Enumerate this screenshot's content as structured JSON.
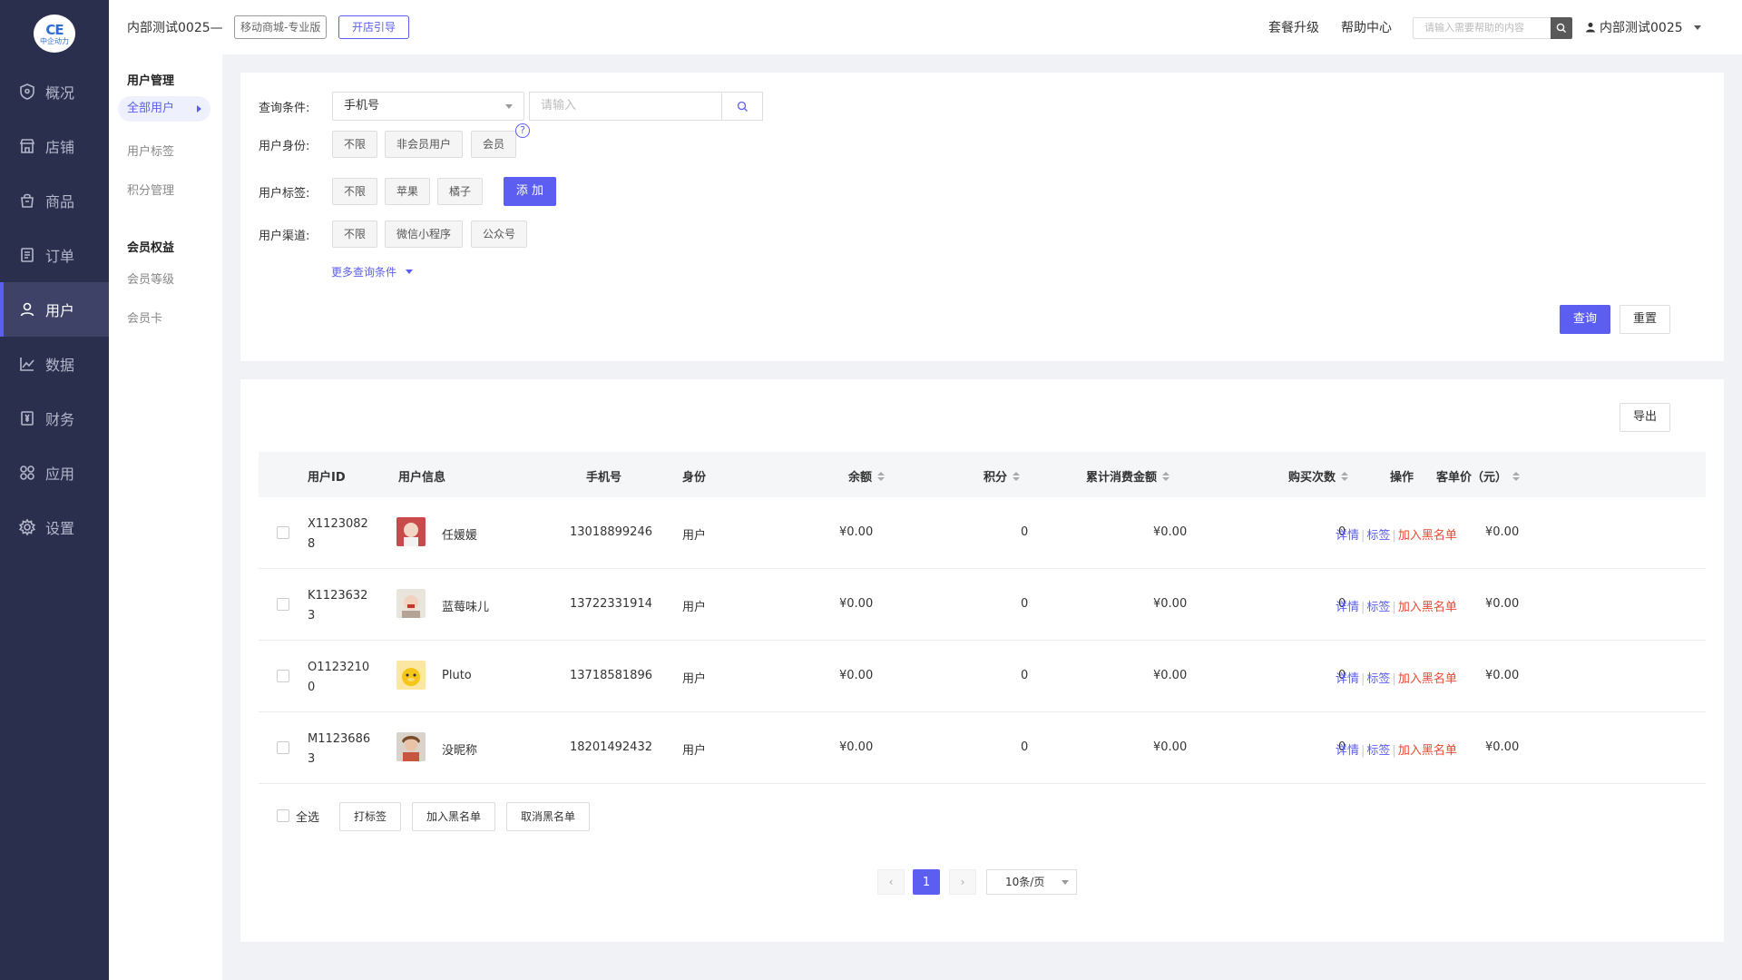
{
  "logo": {
    "mark": "CE",
    "sub": "中企动力"
  },
  "nav": [
    {
      "label": "概况",
      "icon": "shield-icon"
    },
    {
      "label": "店铺",
      "icon": "store-icon"
    },
    {
      "label": "商品",
      "icon": "bag-icon"
    },
    {
      "label": "订单",
      "icon": "order-icon"
    },
    {
      "label": "用户",
      "icon": "user-icon"
    },
    {
      "label": "数据",
      "icon": "chart-icon"
    },
    {
      "label": "财务",
      "icon": "finance-icon"
    },
    {
      "label": "应用",
      "icon": "apps-icon"
    },
    {
      "label": "设置",
      "icon": "gear-icon"
    }
  ],
  "subnav": {
    "group1": "用户管理",
    "items1": [
      "全部用户",
      "用户标签",
      "积分管理"
    ],
    "group2": "会员权益",
    "items2": [
      "会员等级",
      "会员卡"
    ]
  },
  "header": {
    "store": "内部测试0025—",
    "edition": "移动商城-专业版",
    "guide": "开店引导",
    "upgrade": "套餐升级",
    "help": "帮助中心",
    "search_placeholder": "请输入需要帮助的内容",
    "user": "内部测试0025"
  },
  "filters": {
    "query_label": "查询条件:",
    "query_select": "手机号",
    "query_placeholder": "请输入",
    "identity_label": "用户身份:",
    "identity": [
      "不限",
      "非会员用户",
      "会员"
    ],
    "tag_label": "用户标签:",
    "tags": [
      "不限",
      "苹果",
      "橘子"
    ],
    "add": "添 加",
    "channel_label": "用户渠道:",
    "channels": [
      "不限",
      "微信小程序",
      "公众号"
    ],
    "more": "更多查询条件",
    "search": "查询",
    "reset": "重置"
  },
  "table": {
    "export": "导出",
    "headers": {
      "id": "用户ID",
      "info": "用户信息",
      "phone": "手机号",
      "role": "身份",
      "balance": "余额",
      "points": "积分",
      "total": "累计消费金额",
      "count": "购买次数",
      "avg": "客单价（元）",
      "ops": "操作"
    },
    "rows": [
      {
        "id1": "X1123082",
        "id2": "8",
        "name": "任媛媛",
        "phone": "13018899246",
        "role": "用户",
        "balance": "¥0.00",
        "points": "0",
        "total": "¥0.00",
        "count": "0",
        "avg": "¥0.00"
      },
      {
        "id1": "K1123632",
        "id2": "3",
        "name": "蓝莓味儿",
        "phone": "13722331914",
        "role": "用户",
        "balance": "¥0.00",
        "points": "0",
        "total": "¥0.00",
        "count": "0",
        "avg": "¥0.00"
      },
      {
        "id1": "O1123210",
        "id2": "0",
        "name": "Pluto",
        "phone": "13718581896",
        "role": "用户",
        "balance": "¥0.00",
        "points": "0",
        "total": "¥0.00",
        "count": "0",
        "avg": "¥0.00"
      },
      {
        "id1": "M1123686",
        "id2": "3",
        "name": "没昵称",
        "phone": "18201492432",
        "role": "用户",
        "balance": "¥0.00",
        "points": "0",
        "total": "¥0.00",
        "count": "0",
        "avg": "¥0.00"
      }
    ],
    "ops": {
      "detail": "详情",
      "tag": "标签",
      "blacklist": "加入黑名单"
    },
    "bulk": {
      "select_all": "全选",
      "tag": "打标签",
      "blacklist": "加入黑名单",
      "unblacklist": "取消黑名单"
    },
    "pager": {
      "current": "1",
      "size": "10条/页"
    }
  },
  "colors": {
    "sidebar": "#2b2f4e",
    "accent": "#5b5ef0",
    "danger": "#f0462f"
  }
}
